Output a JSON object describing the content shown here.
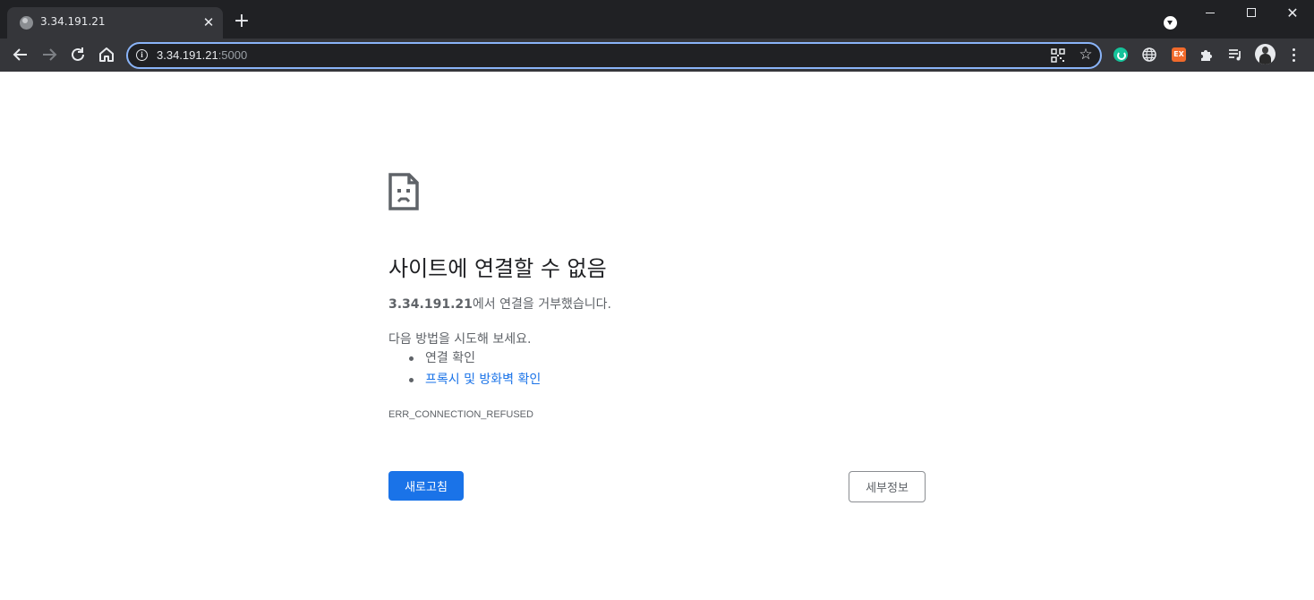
{
  "browser": {
    "tab": {
      "title": "3.34.191.21",
      "close_label": "✕"
    },
    "new_tab_label": "+",
    "window_close_label": "✕",
    "address": {
      "host": "3.34.191.21",
      "port": ":5000"
    },
    "bookmark_label": "☆",
    "extensions": [
      {
        "name": "grammarly-icon",
        "color": "#15c39a"
      },
      {
        "name": "globe-icon"
      },
      {
        "name": "ex-extension-icon",
        "label": "EX",
        "color": "#f16a2b"
      },
      {
        "name": "puzzle-icon"
      },
      {
        "name": "media-control-icon"
      }
    ],
    "accent": "#8ab4f8"
  },
  "error_page": {
    "icon": "sad-page-icon",
    "title": "사이트에 연결할 수 없음",
    "host": "3.34.191.21",
    "description_suffix": "에서 연결을 거부했습니다.",
    "try_label": "다음 방법을 시도해 보세요.",
    "suggestions": [
      {
        "text": "연결 확인",
        "link": false
      },
      {
        "text": "프록시 및 방화벽 확인",
        "link": true
      }
    ],
    "error_code": "ERR_CONNECTION_REFUSED",
    "reload_label": "새로고침",
    "details_label": "세부정보",
    "primary_color": "#1a73e8",
    "link_color": "#1a73e8"
  }
}
